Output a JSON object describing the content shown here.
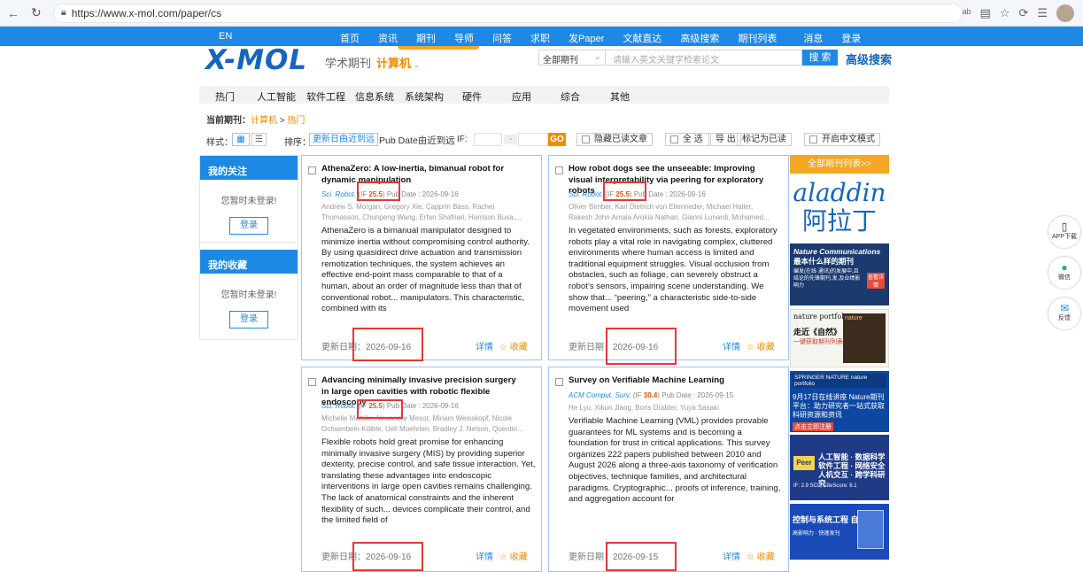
{
  "browser": {
    "url": "https://www.x-mol.com/paper/cs"
  },
  "topnav": {
    "lang": "EN",
    "items": [
      "首页",
      "资讯",
      "期刊",
      "导师",
      "问答",
      "求职",
      "发Paper",
      "文献直达",
      "高级搜索",
      "期刊列表",
      "消息",
      "登录"
    ]
  },
  "header": {
    "logo": "X-MOL",
    "subtitle": "学术期刊",
    "category": "计算机",
    "journal_select": "全部期刊",
    "search_placeholder": "请输入英文关键字检索论文",
    "search_button": "搜 索",
    "advanced_search": "高级搜索"
  },
  "categories": [
    "热门",
    "人工智能",
    "软件工程",
    "信息系统",
    "系统架构",
    "硬件",
    "应用",
    "综合",
    "其他"
  ],
  "breadcrumb": {
    "label": "当前期刊：",
    "journal": "计算机",
    "sep": ">",
    "current": "热门"
  },
  "toolbar": {
    "style_label": "样式：",
    "sort_label": "排序：",
    "sort_active": "更新日由近到远",
    "sort_other": "Pub Date由近到远",
    "if_label": "IF:",
    "if_dash": "-",
    "go": "GO",
    "hide_read": "隐藏已读文章",
    "select_all": "全 选",
    "export": "导 出",
    "mark_read": "标记为已读",
    "chinese_mode": "开启中文模式"
  },
  "sidebar": {
    "follow_title": "我的关注",
    "follow_text": "您暂时未登录!",
    "follow_btn": "登录",
    "fav_title": "我的收藏",
    "fav_text": "您暂时未登录!",
    "fav_btn": "登录"
  },
  "cards": [
    {
      "title": "AthenaZero: A low-inertia, bimanual robot for dynamic manipulation",
      "journal": "Sci. Robot.",
      "if": "25.5",
      "pub_date": "Pub Date : 2026-09-16",
      "authors": "Andrew S. Morgan, Gregory Xie, Capprin Bass, Rachel Thomasson, Chunpeng Wang, Erfan Shafriari, Harrison Busa,...",
      "abstract": "AthenaZero is a bimanual manipulator designed to minimize inertia without compromising control authority. By using quasidirect drive actuation and transmission remotization techniques, the system achieves an effective end-point mass comparable to that of a human, about an order of magnitude less than that of conventional robot... manipulators. This characteristic, combined with its",
      "update_label": "更新日期：",
      "update_date": "2026-09-16",
      "detail": "详情",
      "fav": "☆ 收藏"
    },
    {
      "title": "How robot dogs see the unseeable: Improving visual interpretability via peering for exploratory robots",
      "journal": "Sci. Robot.",
      "if": "25.5",
      "pub_date": "Pub Date : 2026-09-16",
      "authors": "Oliver Bimber, Karl Dietrich von Ellenrieder, Michael Haller, Rakesh John Amala Arokia Nathan, Gianni Lunardi, Mohamed...",
      "abstract": "In vegetated environments, such as forests, exploratory robots play a vital role in navigating complex, cluttered environments where human access is limited and traditional equipment struggles. Visual occlusion from obstacles, such as foliage, can severely obstruct a robot’s sensors, impairing scene understanding. We show that... “peering,” a characteristic side-to-side movement used",
      "update_label": "更新日期：",
      "update_date": "2026-09-16",
      "detail": "详情",
      "fav": "☆ 收藏"
    },
    {
      "title": "Advancing minimally invasive precision surgery in large open cavities with robotic flexible endoscopy",
      "journal": "Sci. Robot.",
      "if": "25.5",
      "pub_date": "Pub Date : 2026-09-16",
      "authors": "Michelle Mattille, Alexandre Mesot, Miriam Weisskopf, Nicole Ochsenbein-Kölble, Ueli Moehrlen, Bradley J. Nelson, Quentin...",
      "abstract": "Flexible robots hold great promise for enhancing minimally invasive surgery (MIS) by providing superior dexterity, precise control, and safe tissue interaction. Yet, translating these advantages into endoscopic interventions in large open cavities remains challenging. The lack of anatomical constraints and the inherent flexibility of such... devices complicate their control, and the limited field of",
      "update_label": "更新日期：",
      "update_date": "2026-09-16",
      "detail": "详情",
      "fav": "☆ 收藏"
    },
    {
      "title": "Survey on Verifiable Machine Learning",
      "journal": "ACM Comput. Surv.",
      "if": "30.4",
      "pub_date": "Pub Date : 2026-09-15",
      "authors": "He Lyu, Xikun Jiang, Boris Düdder, Yuya Sasaki",
      "abstract": "Verifiable Machine Learning (VML) provides provable guarantees for ML systems and is becoming a foundation for trust in critical applications. This survey organizes 222 papers published between 2010 and August 2026 along a three-axis taxonomy of verification objectives, technique families, and architectural paradigms. Cryptographic... proofs of inference, training, and aggregation account for",
      "update_label": "更新日期：",
      "update_date": "2026-09-15",
      "detail": "详情",
      "fav": "☆ 收藏"
    }
  ],
  "right": {
    "all_journals": "全部期刊列表>>",
    "ad_aladdin_en": "aladdin",
    "ad_aladdin_cn": "阿拉丁",
    "ad_nc_title": "Nature Communications",
    "ad_nc_sub": "最本什么样的期刊",
    "ad_nc_small": "编发(在线·通讯)的发展中,且结论的先锋期刊,发,及业绩影响力",
    "ad_nc_btn": "查看详情",
    "ad_nature_logo": "nature portfolio",
    "ad_nature_title": "走近《自然》",
    "ad_nature_sub": "一键获取期刊列表",
    "ad_sn_band": "SPRINGER NATURE  nature portfolio",
    "ad_sn_text": "9月17日在线讲座 Nature期刊平台：助力研究者一站式获取科研资源和资讯",
    "ad_sn_btn": "点击立即注册",
    "ad_peer_logo": "Peer",
    "ad_peer_text": "人工智能 · 数据科学 软件工程 · 网络安全 人机交互 · 跨学科研究",
    "ad_peer_bottom": "IF: 2.9 SCI | CiteScore: 6.1",
    "ad_ce_text": "控制与系统工程 自动化",
    "ad_ce_sub": "高影响力 · 快速发刊"
  },
  "float_buttons": {
    "app": "APP下载",
    "wechat": "微信",
    "feedback": "反馈"
  }
}
